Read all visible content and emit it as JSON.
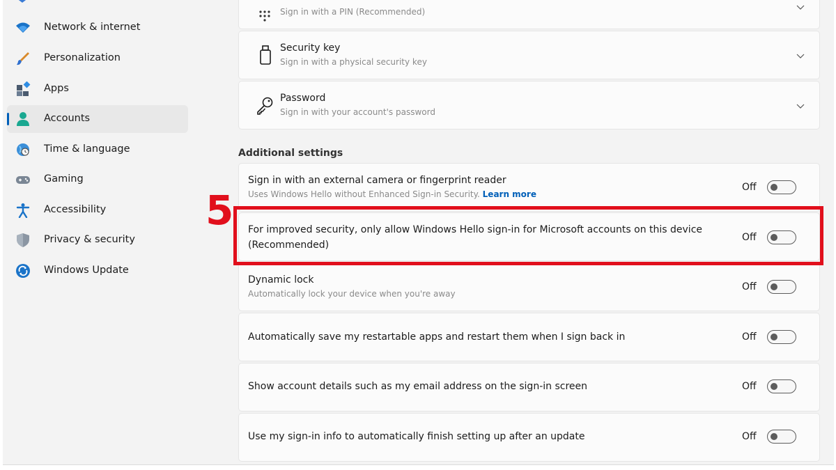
{
  "sidebar": {
    "items": [
      {
        "label": "Network & internet",
        "icon": "wifi-icon"
      },
      {
        "label": "Personalization",
        "icon": "paintbrush-icon"
      },
      {
        "label": "Apps",
        "icon": "apps-icon"
      },
      {
        "label": "Accounts",
        "icon": "person-icon",
        "selected": true
      },
      {
        "label": "Time & language",
        "icon": "globe-clock-icon"
      },
      {
        "label": "Gaming",
        "icon": "gamepad-icon"
      },
      {
        "label": "Accessibility",
        "icon": "accessibility-icon"
      },
      {
        "label": "Privacy & security",
        "icon": "shield-icon"
      },
      {
        "label": "Windows Update",
        "icon": "update-icon"
      }
    ]
  },
  "sign_in_options": {
    "pin": {
      "subtitle": "Sign in with a PIN (Recommended)",
      "icon": "pin-keypad-icon"
    },
    "security_key": {
      "title": "Security key",
      "subtitle": "Sign in with a physical security key",
      "icon": "usb-key-icon"
    },
    "password": {
      "title": "Password",
      "subtitle": "Sign in with your account's password",
      "icon": "key-icon"
    }
  },
  "additional_settings": {
    "heading": "Additional settings",
    "items": [
      {
        "title": "Sign in with an external camera or fingerprint reader",
        "subtitle": "Uses Windows Hello without Enhanced Sign-in Security.",
        "link": "Learn more",
        "state": "Off",
        "on": false
      },
      {
        "title": "For improved security, only allow Windows Hello sign-in for Microsoft accounts on this device",
        "title_line2": "(Recommended)",
        "state": "Off",
        "on": false
      },
      {
        "title": "Dynamic lock",
        "subtitle": "Automatically lock your device when you're away",
        "state": "Off",
        "on": false
      },
      {
        "title": "Automatically save my restartable apps and restart them when I sign back in",
        "state": "Off",
        "on": false
      },
      {
        "title": "Show account details such as my email address on the sign-in screen",
        "state": "Off",
        "on": false
      },
      {
        "title": "Use my sign-in info to automatically finish setting up after an update",
        "state": "Off",
        "on": false
      }
    ]
  },
  "annotation": {
    "step": "5",
    "color": "#e10f1c"
  },
  "colors": {
    "accent": "#005fb8",
    "background": "#f3f3f3",
    "card": "#fbfbfb"
  }
}
